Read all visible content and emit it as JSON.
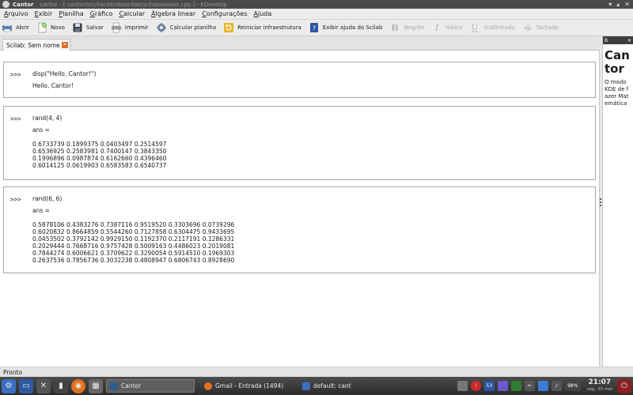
{
  "window": {
    "title": "Cantor",
    "path": "cantor - [ cantor/src/backends/scilab/scilabsession.cpp ] - KDevelop"
  },
  "menubar": {
    "items": [
      "Arquivo",
      "Exibir",
      "Planilha",
      "Gráfico",
      "Calcular",
      "Álgebra linear",
      "Configurações",
      "Ajuda"
    ]
  },
  "toolbar": {
    "buttons": [
      {
        "label": "Abrir",
        "icon": "printer-open-icon",
        "enabled": true
      },
      {
        "label": "Novo",
        "icon": "new-document-icon",
        "enabled": true
      },
      {
        "label": "Salvar",
        "icon": "floppy-save-icon",
        "enabled": true
      },
      {
        "label": "Imprimir",
        "icon": "printer-icon",
        "enabled": true
      },
      {
        "label": "Calcular planilha",
        "icon": "gear-icon",
        "enabled": true
      },
      {
        "label": "Reiniciar infraestrutura",
        "icon": "restart-icon",
        "enabled": true
      },
      {
        "label": "Exibir ajuda do Scilab",
        "icon": "help-book-icon",
        "enabled": true
      },
      {
        "label": "Negrito",
        "icon": "bold-icon",
        "enabled": false
      },
      {
        "label": "Itálico",
        "icon": "italic-icon",
        "enabled": false
      },
      {
        "label": "Sublinhado",
        "icon": "underline-icon",
        "enabled": false
      },
      {
        "label": "Tachado",
        "icon": "strikethrough-icon",
        "enabled": false
      }
    ]
  },
  "tabs": [
    {
      "label": "Scilab: Sem nome"
    }
  ],
  "worksheet": {
    "prompt": ">>>",
    "entries": [
      {
        "command": "disp(\"Hello, Cantor!\")",
        "header": "",
        "lines": [
          "Hello, Cantor!"
        ]
      },
      {
        "command": "rand(4, 4)",
        "header": "ans =",
        "lines": [
          "0.6733739 0.1899375 0.0403497 0.2514597",
          "0.6536925 0.2583981 0.7400147 0.3843350",
          "0.1996896 0.0987874 0.6162660 0.4396460",
          "0.6014125 0.0619903 0.6583583 0.6540737"
        ]
      },
      {
        "command": "rand(6, 6)",
        "header": "ans =",
        "lines": [
          "0.5878106 0.4383276 0.7387116 0.9519520 0.3303696 0.0739296",
          "0.6020832 0.8664859 0.5544260 0.7127858 0.6304475 0.9433695",
          "0.0453502 0.3792142 0.9929150 0.1192370 0.2117191 0.1286331",
          "0.2029444 0.7668716 0.9757428 0.5009163 0.4486023 0.2019081",
          "0.7844274 0.6006621 0.3709622 0.3290054 0.5914510 0.1969303",
          "0.2637536 0.7856736 0.3032238 0.4808947 0.6806743 0.8928690"
        ]
      }
    ]
  },
  "help_panel": {
    "title": "Cantor",
    "text": "O modo KDE de fazer Matemática"
  },
  "statusbar": {
    "text": "Pronto"
  },
  "taskbar": {
    "tasks": [
      {
        "label": "Cantor",
        "active": true
      },
      {
        "label": "Gmail - Entrada (1494)",
        "active": false
      },
      {
        "label": "default: cant",
        "active": false
      }
    ],
    "tray_badge": "53",
    "battery": "98%",
    "clock_time": "21:07",
    "clock_date": "seg, 30 mai"
  },
  "colors": {
    "accent_close": "#e06a2a",
    "titlebar": "#4a4a4a",
    "taskbar": "#2b2b2b"
  }
}
